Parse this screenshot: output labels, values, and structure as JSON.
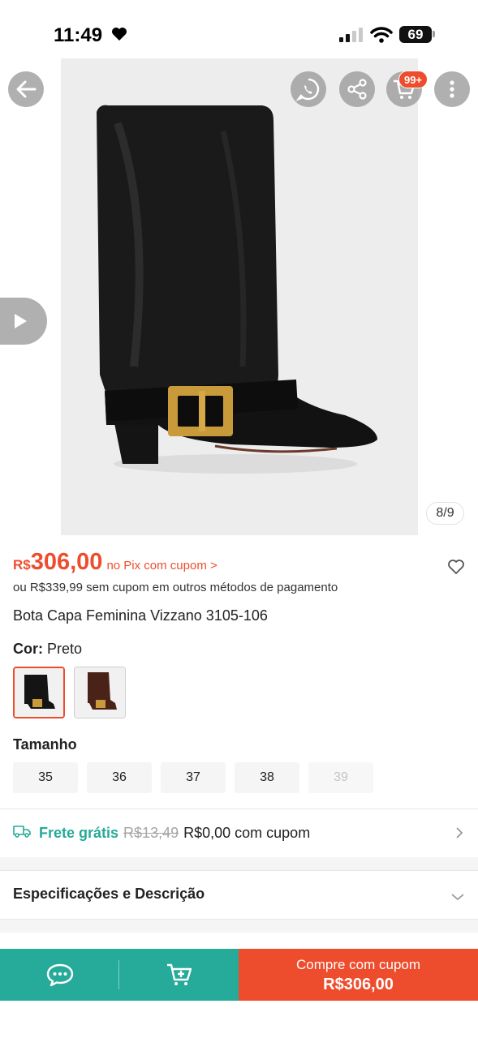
{
  "status_bar": {
    "time": "11:49",
    "battery": "69"
  },
  "gallery": {
    "counter": "8/9",
    "cart_badge": "99+"
  },
  "price": {
    "currency": "R$",
    "value": "306,00",
    "note": "no Pix com cupom >",
    "alt_text": "ou R$339,99 sem cupom em outros métodos de pagamento"
  },
  "product": {
    "title": "Bota Capa Feminina Vizzano 3105-106"
  },
  "color": {
    "label": "Cor:",
    "value": "Preto"
  },
  "size": {
    "label": "Tamanho",
    "options": [
      "35",
      "36",
      "37",
      "38",
      "39"
    ]
  },
  "shipping": {
    "free_label": "Frete grátis",
    "old_price": "R$13,49",
    "new_price": "R$0,00 com cupom"
  },
  "specs": {
    "label": "Especificações e Descrição"
  },
  "bottom_bar": {
    "buy_label": "Compre com cupom",
    "buy_price": "R$306,00"
  },
  "colors": {
    "accent": "#ee4d2d",
    "teal": "#26aa99"
  }
}
